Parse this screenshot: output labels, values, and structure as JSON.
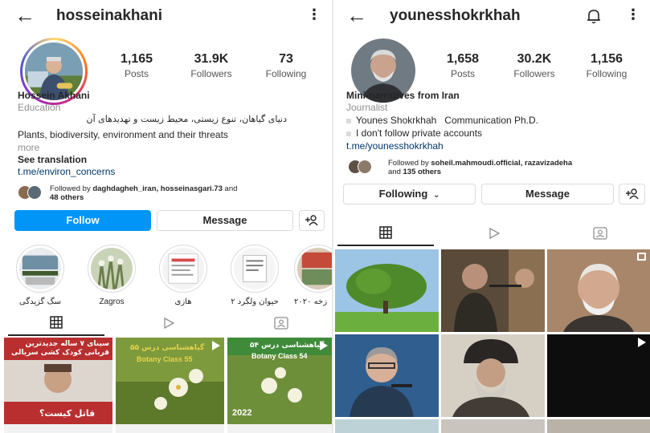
{
  "left": {
    "username": "hosseinakhani",
    "stats": [
      {
        "num": "1,165",
        "label": "Posts"
      },
      {
        "num": "31.9K",
        "label": "Followers"
      },
      {
        "num": "73",
        "label": "Following"
      }
    ],
    "name": "Hossein Akhani",
    "category": "Education",
    "bio_fa": "دنیای گیاهان، تنوع زیستی، محیط زیست و تهدیدهای آن",
    "bio_en": "Plants, biodiversity, environment and their threats",
    "more": "more",
    "see_translation": "See translation",
    "link": "t.me/environ_concerns",
    "followed_by_prefix": "Followed by",
    "followed_by_names": "daghdagheh_iran, hosseinasgari.73",
    "followed_by_suffix": "and",
    "followed_by_others": "48 others",
    "follow_btn": "Follow",
    "message_btn": "Message",
    "highlights": [
      {
        "caption": "سگ گزیدگی"
      },
      {
        "caption": "Zagros"
      },
      {
        "caption": "هازی"
      },
      {
        "caption": "حیوان ولگرد ۲"
      },
      {
        "caption": "زخه ۲۰۲۰"
      }
    ],
    "posts": [
      {
        "top": "سینای ۷ ساله جدیدترین قربانی کودک کشی سریالی",
        "bottom": "قاتل کیست؟"
      },
      {
        "top": "گیاهشناسی درس ۵۵",
        "bottom": "Botany Class 55"
      },
      {
        "top": "گیاهشناسی درس ۵۴",
        "bottom": "Botany Class 54",
        "year": "2022"
      }
    ]
  },
  "right": {
    "username": "younesshokrkhah",
    "stats": [
      {
        "num": "1,658",
        "label": "Posts"
      },
      {
        "num": "30.2K",
        "label": "Followers"
      },
      {
        "num": "1,156",
        "label": "Following"
      }
    ],
    "headline": "Mini-narratives from Iran",
    "category": "Journalist",
    "bio_line1": "Younes Shokrkhah   Communication Ph.D.",
    "bio_line2": "I don't follow private accounts",
    "link": "t.me/younesshokrkhah",
    "followed_by_prefix": "Followed by",
    "followed_by_names": "soheil.mahmoudi.official, razavizadeha",
    "followed_by_suffix": "and",
    "followed_by_others": "135 others",
    "following_btn": "Following",
    "message_btn": "Message"
  },
  "colors": {
    "primary_blue": "#0095f6",
    "link_blue": "#00376b",
    "text": "#262626",
    "muted": "#8e8e8e",
    "border": "#dbdbdb"
  },
  "icons": [
    "back-arrow-icon",
    "more-vertical-icon",
    "bell-icon",
    "add-person-icon",
    "grid-icon",
    "reels-icon",
    "tagged-icon",
    "chevron-down-icon",
    "reel-icon",
    "multi-image-icon"
  ]
}
